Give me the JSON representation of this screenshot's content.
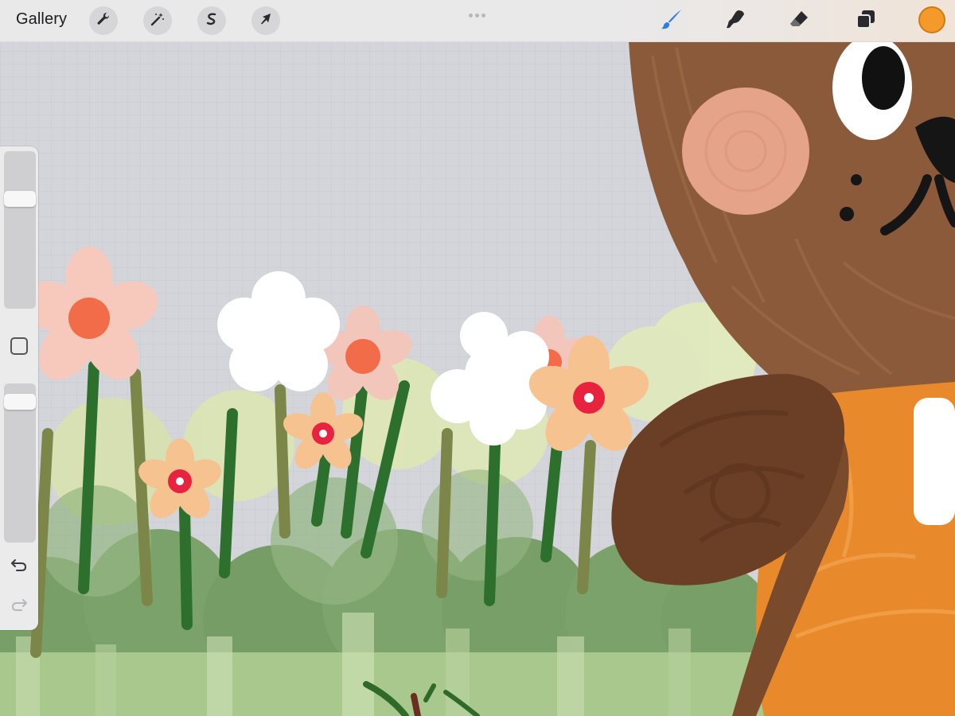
{
  "topbar": {
    "gallery_label": "Gallery",
    "left_tools": [
      "wrench-icon",
      "magic-wand-icon",
      "selection-s-icon",
      "arrow-transform-icon"
    ],
    "right_tools": [
      "brush-icon",
      "smudge-icon",
      "eraser-icon",
      "layers-icon"
    ],
    "active_tool": "brush-icon",
    "accent_color": "#2f7de1",
    "current_color": "#f49a2a"
  },
  "sidebar": {
    "brush_size_level": 0.72,
    "opacity_level": 0.93,
    "undo_icon": "undo-icon",
    "redo_icon": "redo-icon"
  }
}
